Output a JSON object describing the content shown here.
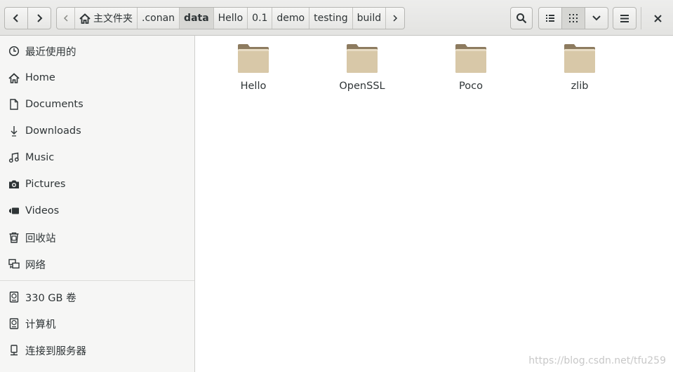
{
  "header": {
    "path": [
      {
        "label": "主文件夹",
        "home": true
      },
      {
        "label": ".conan"
      },
      {
        "label": "data",
        "active": true
      },
      {
        "label": "Hello"
      },
      {
        "label": "0.1"
      },
      {
        "label": "demo"
      },
      {
        "label": "testing"
      },
      {
        "label": "build"
      }
    ]
  },
  "sidebar": {
    "items": [
      {
        "label": "最近使用的",
        "icon": "clock-icon"
      },
      {
        "label": "Home",
        "icon": "home-icon"
      },
      {
        "label": "Documents",
        "icon": "document-icon"
      },
      {
        "label": "Downloads",
        "icon": "download-icon"
      },
      {
        "label": "Music",
        "icon": "music-icon"
      },
      {
        "label": "Pictures",
        "icon": "camera-icon"
      },
      {
        "label": "Videos",
        "icon": "video-icon"
      },
      {
        "label": "回收站",
        "icon": "trash-icon"
      },
      {
        "label": "网络",
        "icon": "network-icon"
      },
      {
        "label": "330 GB 卷",
        "icon": "drive-icon"
      },
      {
        "label": "计算机",
        "icon": "drive-icon"
      },
      {
        "label": "连接到服务器",
        "icon": "server-icon"
      }
    ]
  },
  "files": [
    {
      "name": "Hello"
    },
    {
      "name": "OpenSSL"
    },
    {
      "name": "Poco"
    },
    {
      "name": "zlib"
    }
  ],
  "watermark": "https://blog.csdn.net/tfu259",
  "colors": {
    "folder": "#d8c8a8",
    "folder_dark": "#8d7b5f"
  }
}
